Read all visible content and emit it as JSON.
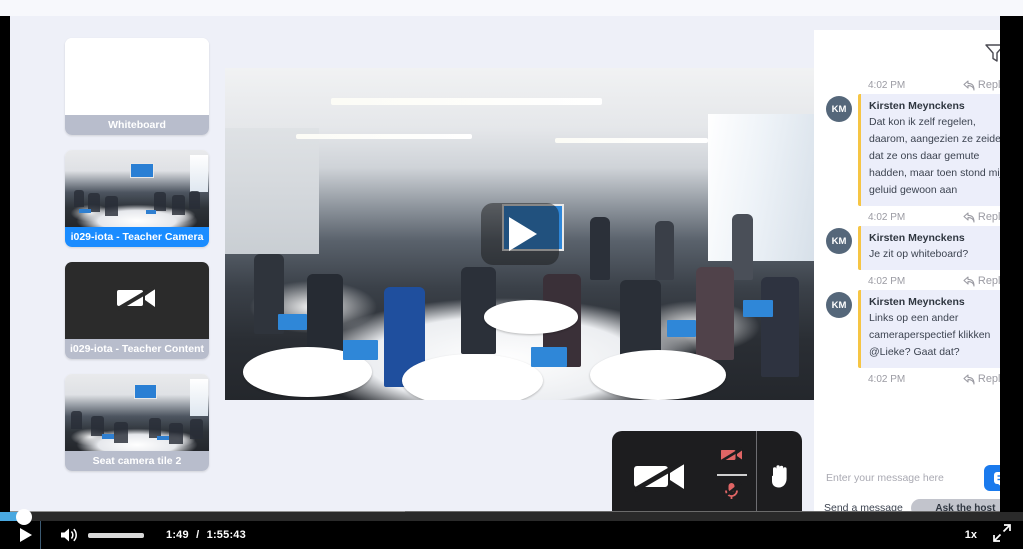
{
  "thumbnails": [
    {
      "label": "Whiteboard",
      "active": false,
      "kind": "blank"
    },
    {
      "label": "i029-iota - Teacher Camera",
      "active": true,
      "kind": "classroom"
    },
    {
      "label": "i029-iota - Teacher Content",
      "active": false,
      "kind": "camera-off"
    },
    {
      "label": "Seat camera tile 2",
      "active": false,
      "kind": "classroom"
    }
  ],
  "video": {
    "play_label": "Play",
    "play_icon": "play-triangle-icon"
  },
  "pod": {
    "camera_off_icon": "camera-off-icon",
    "camera_muted_icon": "camera-muted-red-icon",
    "mic_muted_icon": "microphone-muted-red-icon",
    "raise_hand_icon": "raised-hand-icon"
  },
  "chat": {
    "filter_icon": "filter-funnel-icon",
    "messages": [
      {
        "time": "4:02 PM",
        "reply_label": "Reply",
        "initials": "KM",
        "author": "Kirsten Meynckens",
        "text": "Dat kon ik zelf regelen, daarom, aangezien ze zeiden dat ze ons daar gemute hadden, maar toen stond mijn geluid gewoon aan"
      },
      {
        "time": "4:02 PM",
        "reply_label": "Reply",
        "initials": "KM",
        "author": "Kirsten Meynckens",
        "text": "Je zit op whiteboard?"
      },
      {
        "time": "4:02 PM",
        "reply_label": "Reply",
        "initials": "KM",
        "author": "Kirsten Meynckens",
        "text": "Links op een ander cameraperspectief klikken @Lieke? Gaat dat?"
      }
    ],
    "last_meta": {
      "time": "4:02 PM",
      "reply_label": "Reply"
    },
    "composer": {
      "placeholder": "Enter your message here",
      "value": "",
      "send_icon": "send-chat-icon"
    },
    "footer": {
      "send_message_label": "Send a message",
      "ask_host_label": "Ask the host"
    }
  },
  "player": {
    "play_icon": "play-icon",
    "volume_icon": "volume-on-icon",
    "current_time": "1:49",
    "separator": "/",
    "duration": "1:55:43",
    "speed": "1x",
    "fullscreen_icon": "fullscreen-icon",
    "progress_percent": 2
  },
  "colors": {
    "accent_blue": "#1a8cff",
    "send_blue": "#1a7aed",
    "bubble_bg": "#eceefa",
    "bubble_accent": "#f6c544",
    "avatar_bg": "#55677a",
    "progress_fill": "#49a8e0",
    "inactive_label": "#b8bdcc"
  }
}
